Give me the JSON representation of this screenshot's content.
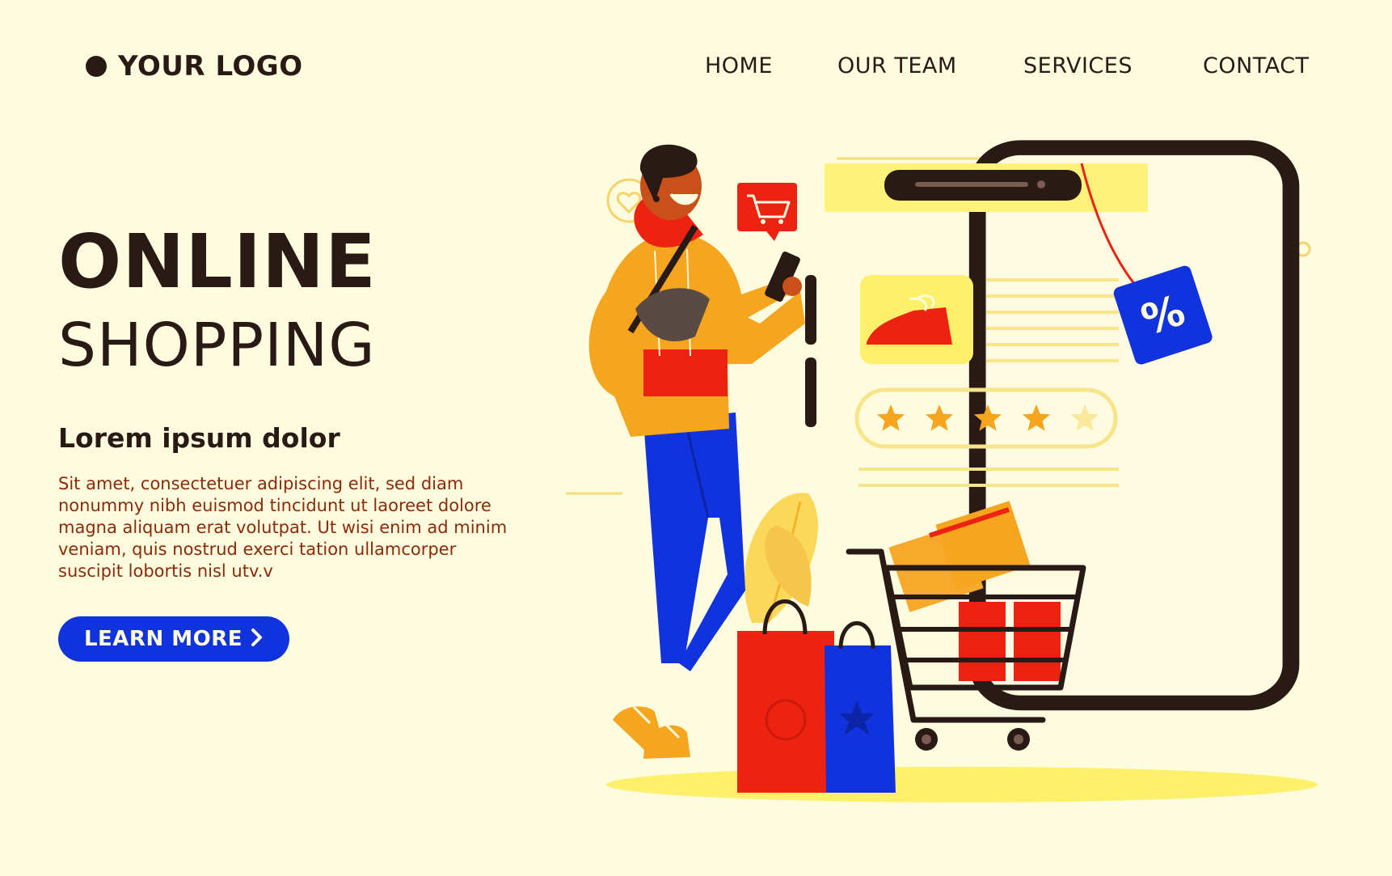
{
  "header": {
    "logo_text": "YOUR LOGO",
    "nav": [
      "HOME",
      "OUR TEAM",
      "SERVICES",
      "CONTACT"
    ]
  },
  "hero": {
    "title_line1": "ONLINE",
    "title_line2": "SHOPPING",
    "subheading": "Lorem ipsum dolor",
    "paragraph": "Sit amet, consectetuer adipiscing elit, sed diam nonummy nibh euismod tincidunt ut laoreet dolore magna aliquam erat volutpat. Ut wisi enim ad minim veniam, quis nostrud exerci tation ullamcorper suscipit lobortis nisl utv.v",
    "cta_label": "LEARN MORE",
    "cta_icon": "chevron-right-icon"
  },
  "illustration": {
    "rating": {
      "filled": 4,
      "total": 5
    },
    "discount_tag": "%",
    "currency_symbol": "$",
    "icons": [
      "heart-icon",
      "shopping-cart-icon",
      "dollar-icon",
      "star-icon",
      "shoe-icon",
      "shopping-bag-icon",
      "discount-tag-icon"
    ]
  },
  "colors": {
    "background": "#fefcde",
    "text_dark": "#2a1a16",
    "paragraph_text": "#8b2a0a",
    "accent_blue": "#1133dd",
    "accent_red": "#ee2211",
    "accent_orange": "#f5a51e",
    "accent_yellow": "#fff06a"
  }
}
